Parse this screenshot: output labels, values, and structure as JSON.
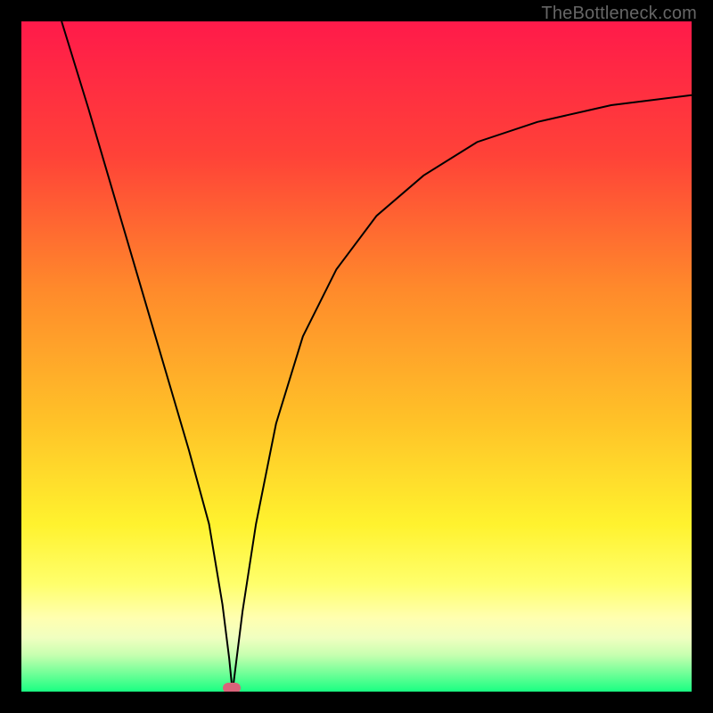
{
  "watermark": "TheBottleneck.com",
  "chart_data": {
    "type": "line",
    "title": "",
    "xlabel": "",
    "ylabel": "",
    "xlim": [
      0,
      100
    ],
    "ylim": [
      0,
      100
    ],
    "grid": false,
    "series": [
      {
        "name": "curve",
        "x": [
          6,
          10,
          15,
          20,
          25,
          28,
          30,
          31,
          31.5,
          32,
          33,
          35,
          38,
          42,
          47,
          53,
          60,
          68,
          77,
          88,
          100
        ],
        "y": [
          100,
          87,
          70,
          53,
          36,
          25,
          13,
          5,
          0,
          4,
          12,
          25,
          40,
          53,
          63,
          71,
          77,
          82,
          85,
          87.5,
          89
        ]
      }
    ],
    "marker": {
      "x": 31.4,
      "y": 0.5
    },
    "gradient_stops": [
      {
        "pos": 0,
        "color": "#ff1a4a"
      },
      {
        "pos": 20,
        "color": "#ff4238"
      },
      {
        "pos": 40,
        "color": "#ff8a2b"
      },
      {
        "pos": 60,
        "color": "#ffc328"
      },
      {
        "pos": 75,
        "color": "#fff22e"
      },
      {
        "pos": 84,
        "color": "#ffff6c"
      },
      {
        "pos": 89,
        "color": "#ffffb0"
      },
      {
        "pos": 92,
        "color": "#f0ffc0"
      },
      {
        "pos": 94.5,
        "color": "#c8ffb0"
      },
      {
        "pos": 97,
        "color": "#7aff9a"
      },
      {
        "pos": 100,
        "color": "#1aff82"
      }
    ]
  }
}
